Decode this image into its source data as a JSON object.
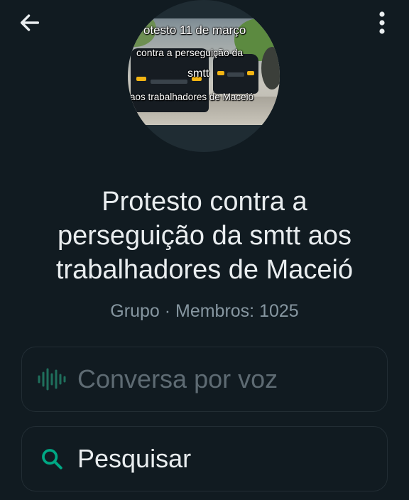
{
  "header": {
    "back_icon": "arrow-left-icon",
    "menu_icon": "more-vertical-icon"
  },
  "avatar": {
    "caption_line1": "otesto 11 de março",
    "caption_line2": "contra a perseguição da",
    "caption_line3": "smtt",
    "caption_line4": "aos trabalhadores de Maceió"
  },
  "group": {
    "title_line1": "Protesto contra a",
    "title_line2": "perseguição da smtt aos",
    "title_line3": "trabalhadores de Maceió",
    "subtitle": "Grupo · Membros: 1025"
  },
  "actions": {
    "voice_chat_label": "Conversa por voz",
    "voice_chat_icon": "audio-wave-icon",
    "search_label": "Pesquisar",
    "search_icon": "search-icon"
  },
  "colors": {
    "background": "#111b21",
    "primary_text": "#e9edef",
    "secondary_text": "#8696a0",
    "accent_green": "#00a884",
    "disabled_green": "#1f6f5c"
  }
}
